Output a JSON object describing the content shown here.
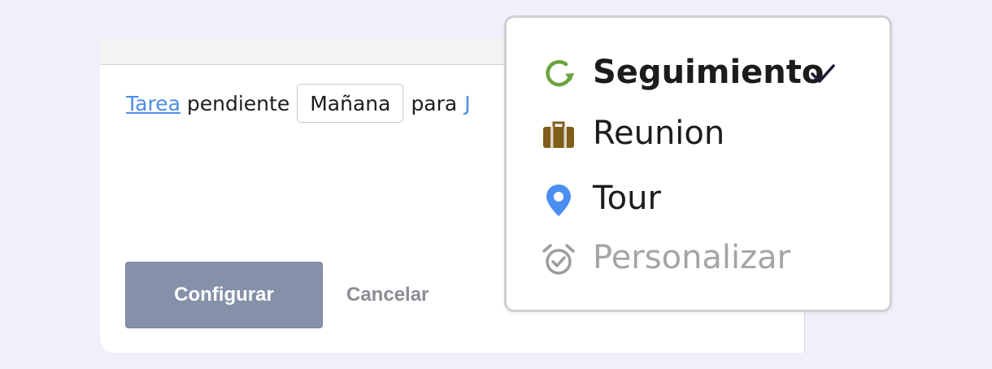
{
  "task_form": {
    "task_link": "Tarea",
    "word_pending": "pendiente",
    "date_value": "Mañana",
    "word_for": "para",
    "assignee_link": "J",
    "configure_label": "Configurar",
    "cancel_label": "Cancelar"
  },
  "task_type_menu": {
    "items": [
      {
        "label": "Seguimiento",
        "icon": "refresh-icon",
        "icon_color": "#6aa43d",
        "selected": true
      },
      {
        "label": "Reunion",
        "icon": "briefcase-icon",
        "icon_color": "#7f5e1c",
        "selected": false
      },
      {
        "label": "Tour",
        "icon": "location-pin-icon",
        "icon_color": "#4a8ef2",
        "selected": false
      },
      {
        "label": "Personalizar",
        "icon": "alarm-clock-icon",
        "icon_color": "#9c9ca1",
        "selected": false
      }
    ],
    "checkmark_icon": "checkmark-icon",
    "checkmark_color": "#1d1a3c"
  },
  "colors": {
    "background": "#f1effb",
    "link": "#4d8ee6",
    "primary_button": "#8591a8",
    "cancel_text": "#8b8d94"
  }
}
